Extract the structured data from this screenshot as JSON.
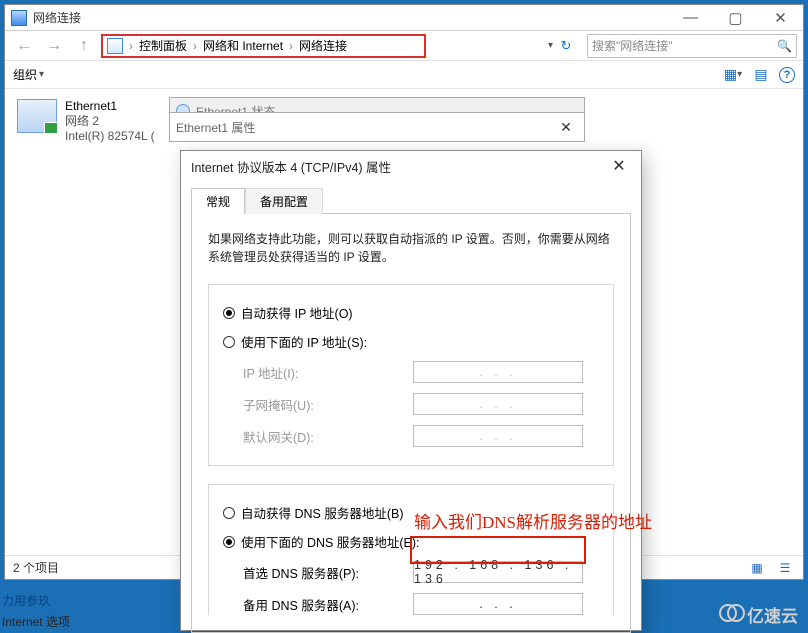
{
  "window": {
    "title": "网络连接",
    "breadcrumb": {
      "p1": "控制面板",
      "p2": "网络和 Internet",
      "p3": "网络连接"
    },
    "search_placeholder": "搜索\"网络连接\"",
    "toolbar": {
      "organize": "组织"
    }
  },
  "adapter": {
    "name": "Ethernet1",
    "network": "网络 2",
    "device": "Intel(R) 82574L ("
  },
  "statusbar": {
    "items_count": "2 个项目"
  },
  "eth_status_title": "Ethernet1 状态",
  "eth_prop_title": "Ethernet1 属性",
  "ipv4": {
    "title": "Internet 协议版本 4 (TCP/IPv4) 属性",
    "tabs": {
      "general": "常规",
      "alt": "备用配置"
    },
    "description": "如果网络支持此功能，则可以获取自动指派的 IP 设置。否则，你需要从网络系统管理员处获得适当的 IP 设置。",
    "radio_auto_ip": "自动获得 IP 地址(O)",
    "radio_use_ip": "使用下面的 IP 地址(S):",
    "label_ip": "IP 地址(I):",
    "label_mask": "子网掩码(U):",
    "label_gateway": "默认网关(D):",
    "radio_auto_dns": "自动获得 DNS 服务器地址(B)",
    "radio_use_dns": "使用下面的 DNS 服务器地址(E):",
    "label_pref_dns": "首选 DNS 服务器(P):",
    "label_alt_dns": "备用 DNS 服务器(A):",
    "ip_dots": ".       .       .",
    "pref_dns_value": "192 . 168 . 136 . 136"
  },
  "annotation": {
    "dns_hint": "输入我们DNS解析服务器的地址"
  },
  "footer": {
    "ref": "力用参玖",
    "options": "Internet 选项"
  },
  "watermark": "亿速云"
}
